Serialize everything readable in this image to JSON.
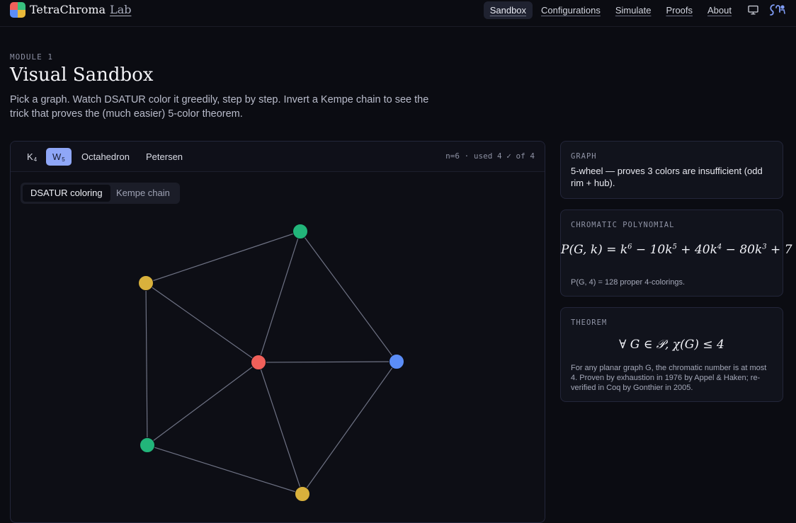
{
  "header": {
    "brand": "TetraChroma",
    "brand_suffix": "Lab",
    "logo_colors": [
      "#f0605a",
      "#38c07e",
      "#5b8df7",
      "#e8b93a"
    ],
    "nav": [
      "Sandbox",
      "Configurations",
      "Simulate",
      "Proofs",
      "About"
    ],
    "active_nav": "Sandbox"
  },
  "hero": {
    "kicker": "MODULE 1",
    "title": "Visual Sandbox",
    "lead": "Pick a graph. Watch DSATUR color it greedily, step by step. Invert a Kempe chain to see the trick that proves the (much easier) 5-color theorem."
  },
  "graph_tabs": [
    {
      "label": "K",
      "sub": "4",
      "active": false
    },
    {
      "label": "W",
      "sub": "5",
      "active": true
    },
    {
      "label": "Octahedron",
      "sub": "",
      "active": false
    },
    {
      "label": "Petersen",
      "sub": "",
      "active": false
    }
  ],
  "stats": "n=6 · used 4 ✓ of 4",
  "modes": [
    "DSATUR coloring",
    "Kempe chain"
  ],
  "active_mode": "DSATUR coloring",
  "colors": {
    "red": "#f0605a",
    "green": "#22b57a",
    "blue": "#5b8df7",
    "yellow": "#d9b13c",
    "edge": "#6e7284"
  },
  "cards": {
    "graph": {
      "label": "GRAPH",
      "text": "5-wheel — proves 3 colors are insufficient (odd rim + hub)."
    },
    "polynomial": {
      "label": "CHROMATIC POLYNOMIAL",
      "formula_lhs": "P(G, k) = ",
      "terms": [
        {
          "coef": "k",
          "exp": "6"
        },
        {
          "coef": " − 10k",
          "exp": "5"
        },
        {
          "coef": " + 40k",
          "exp": "4"
        },
        {
          "coef": " − 80k",
          "exp": "3"
        },
        {
          "coef": " + 7",
          "exp": ""
        }
      ],
      "note": "P(G, 4) = 128 proper 4-colorings."
    },
    "theorem": {
      "label": "THEOREM",
      "formula": "∀ G ∈ 𝒫,  χ(G) ≤ 4",
      "text": "For any planar graph G, the chromatic number is at most 4. Proven by exhaustion in 1976 by Appel & Haken; re-verified in Coq by Gonthier in 2005."
    }
  }
}
